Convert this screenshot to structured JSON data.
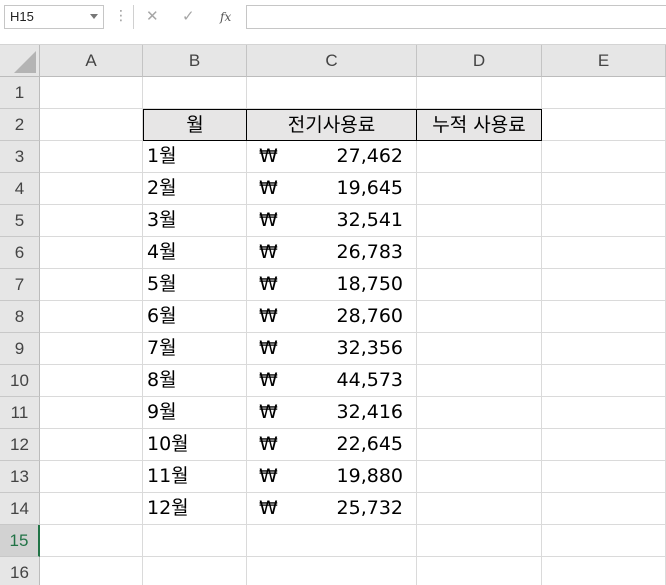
{
  "name_box": "H15",
  "formula_bar": {
    "cancel_icon": "✕",
    "enter_icon": "✓",
    "function_icon": "fx",
    "formula": ""
  },
  "columns": [
    "A",
    "B",
    "C",
    "D",
    "E"
  ],
  "rows": [
    "1",
    "2",
    "3",
    "4",
    "5",
    "6",
    "7",
    "8",
    "9",
    "10",
    "11",
    "12",
    "13",
    "14",
    "15",
    "16"
  ],
  "selected_row": "15",
  "table": {
    "headers": [
      "월",
      "전기사용료",
      "누적 사용료"
    ],
    "currency_symbol": "₩",
    "records": [
      {
        "month": "1월",
        "usage": "27,462",
        "cumulative": ""
      },
      {
        "month": "2월",
        "usage": "19,645",
        "cumulative": ""
      },
      {
        "month": "3월",
        "usage": "32,541",
        "cumulative": ""
      },
      {
        "month": "4월",
        "usage": "26,783",
        "cumulative": ""
      },
      {
        "month": "5월",
        "usage": "18,750",
        "cumulative": ""
      },
      {
        "month": "6월",
        "usage": "28,760",
        "cumulative": ""
      },
      {
        "month": "7월",
        "usage": "32,356",
        "cumulative": ""
      },
      {
        "month": "8월",
        "usage": "44,573",
        "cumulative": ""
      },
      {
        "month": "9월",
        "usage": "32,416",
        "cumulative": ""
      },
      {
        "month": "10월",
        "usage": "22,645",
        "cumulative": ""
      },
      {
        "month": "11월",
        "usage": "19,880",
        "cumulative": ""
      },
      {
        "month": "12월",
        "usage": "25,732",
        "cumulative": ""
      }
    ]
  },
  "colors": {
    "header_fill": "#e7e6e6",
    "selection_accent": "#217346"
  }
}
